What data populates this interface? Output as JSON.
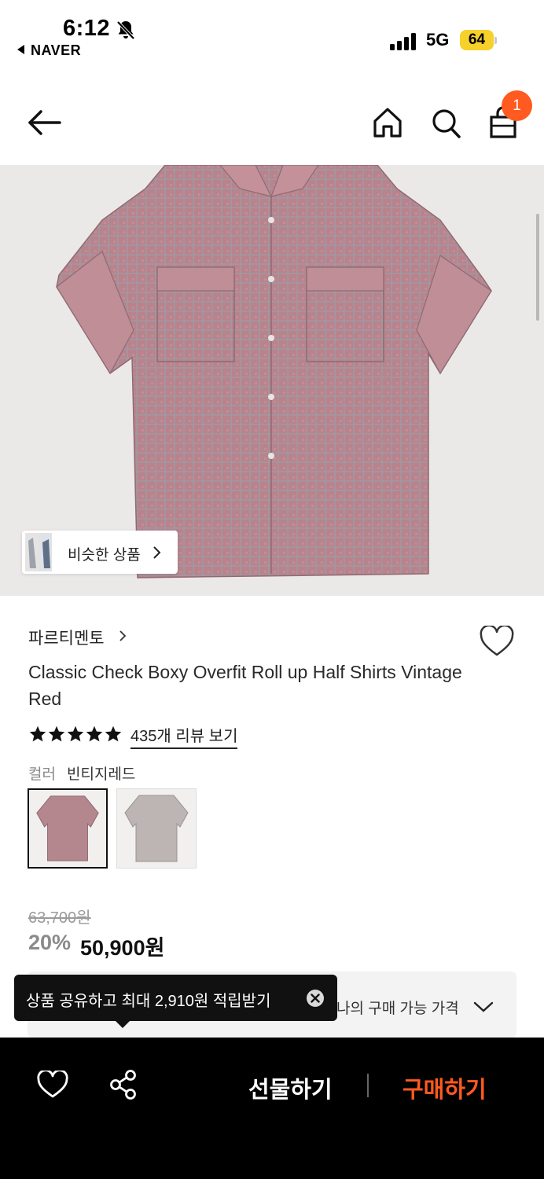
{
  "status_bar": {
    "time": "6:12",
    "back_app": "NAVER",
    "network": "5G",
    "battery": "64"
  },
  "header": {
    "cart_badge": "1",
    "icons": [
      "back-arrow-icon",
      "home-icon",
      "search-icon",
      "shopping-bag-icon"
    ]
  },
  "hero": {
    "similar_button": "비슷한 상품"
  },
  "product": {
    "brand": "파르티멘토",
    "title": "Classic Check Boxy Overfit Roll up Half Shirts Vintage Red",
    "rating_stars": 5,
    "review_link": "435개 리뷰 보기",
    "color_label": "컬러",
    "color_value": "빈티지레드",
    "swatches": [
      {
        "name": "빈티지레드",
        "color": "#b4868e",
        "selected": true
      },
      {
        "name": "grey",
        "color": "#bcb5b3",
        "selected": false
      }
    ],
    "original_price": "63,700원",
    "discount": "20%",
    "sale_price": "50,900원"
  },
  "my_price": {
    "label": "나의 구매 가능 가격"
  },
  "tooltip": {
    "text": "상품 공유하고 최대 2,910원 적립받기"
  },
  "bottom_bar": {
    "gift_label": "선물하기",
    "buy_label": "구매하기",
    "buy_color": "#ff5a1f"
  }
}
